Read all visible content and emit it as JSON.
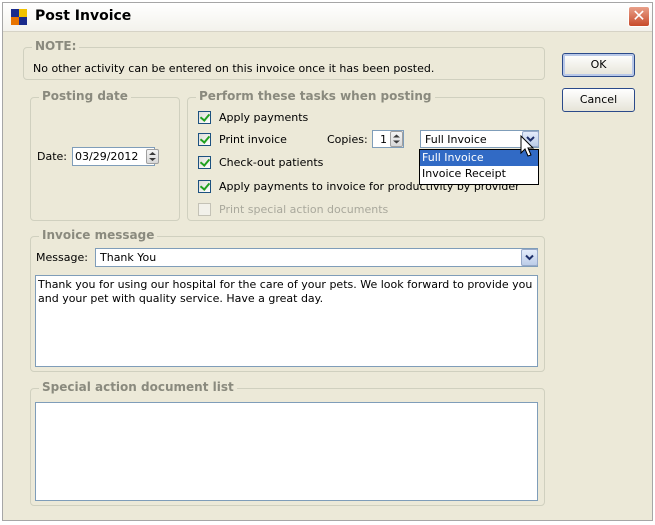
{
  "window": {
    "title": "Post Invoice",
    "close_glyph": "✕"
  },
  "buttons": {
    "ok": "OK",
    "cancel": "Cancel"
  },
  "note": {
    "legend": "NOTE:",
    "text": "No other activity can be entered on this invoice once it has been posted."
  },
  "posting_date": {
    "legend": "Posting date",
    "label": "Date:",
    "value": "03/29/2012"
  },
  "tasks": {
    "legend": "Perform these tasks when posting",
    "apply_payments": {
      "label": "Apply payments",
      "checked": true
    },
    "print_invoice": {
      "label": "Print invoice",
      "checked": true
    },
    "copies_label": "Copies:",
    "copies_value": "1",
    "invoice_type": {
      "selected": "Full Invoice",
      "options": [
        "Full Invoice",
        "Invoice Receipt"
      ],
      "highlighted": "Full Invoice"
    },
    "checkout": {
      "label": "Check-out patients",
      "checked": true
    },
    "apply_productivity": {
      "label": "Apply payments to invoice for productivity by provider",
      "checked": true
    },
    "print_special": {
      "label": "Print special action documents",
      "checked": false,
      "disabled": true
    }
  },
  "invoice_message": {
    "legend": "Invoice message",
    "message_label": "Message:",
    "message_value": "Thank You",
    "body": "Thank you for using our hospital for the care of your pets.  We look forward to provide you and your pet with quality service. Have a great day."
  },
  "special_action": {
    "legend": "Special action document list"
  },
  "colors": {
    "dialog_bg": "#ece9d8",
    "accent": "#316ac5",
    "legend_gray": "#8a8a7e",
    "check_green": "#21a121"
  }
}
